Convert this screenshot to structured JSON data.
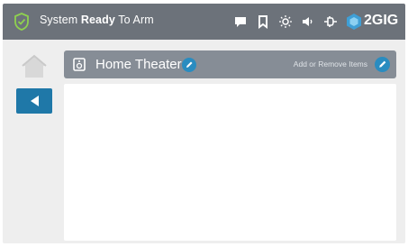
{
  "status_bar": {
    "prefix": "System ",
    "state": "Ready",
    "suffix": " To Arm",
    "icons": [
      "message-icon",
      "bookmark-icon",
      "brightness-icon",
      "volume-icon",
      "plug-icon"
    ],
    "brand": "2GIG",
    "status_color": "#8fd14f"
  },
  "nav": {
    "home": "home-icon",
    "back": "back-arrow-icon",
    "accent": "#1f78a8"
  },
  "room": {
    "title": "Home Theater",
    "add_remove_label": "Add or Remove Items"
  }
}
